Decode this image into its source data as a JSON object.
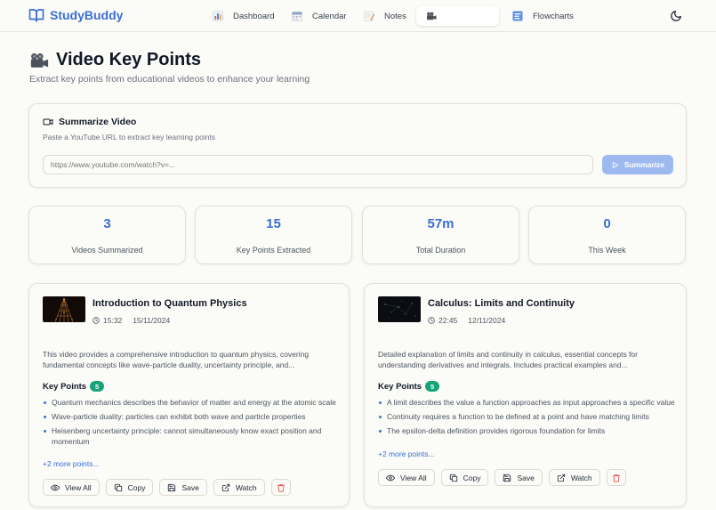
{
  "app": {
    "name": "StudyBuddy",
    "brand_color": "#3b6fd4"
  },
  "nav": {
    "items": [
      {
        "label": "Dashboard",
        "icon": "bar-chart-icon"
      },
      {
        "label": "Calendar",
        "icon": "calendar-icon"
      },
      {
        "label": "Notes",
        "icon": "memo-icon"
      },
      {
        "label": "",
        "icon": "movie-camera-icon",
        "active": true
      },
      {
        "label": "Flowcharts",
        "icon": "chart-icon"
      }
    ],
    "theme_toggle_icon": "moon-icon"
  },
  "header": {
    "title": "Video Key Points",
    "subtitle": "Extract key points from educational videos to enhance your learning"
  },
  "summarize": {
    "title": "Summarize Video",
    "subtitle": "Paste a YouTube URL to extract key learning points",
    "placeholder": "https://www.youtube.com/watch?v=...",
    "button_label": "Summarize"
  },
  "stats": [
    {
      "value": "3",
      "label": "Videos Summarized"
    },
    {
      "value": "15",
      "label": "Key Points Extracted"
    },
    {
      "value": "57m",
      "label": "Total Duration"
    },
    {
      "value": "0",
      "label": "This Week"
    }
  ],
  "videos": [
    {
      "title": "Introduction to Quantum Physics",
      "duration": "15:32",
      "date": "15/11/2024",
      "description": "This video provides a comprehensive introduction to quantum physics, covering fundamental concepts like wave-particle duality, uncertainty principle, and...",
      "key_points_label": "Key Points",
      "key_points_count": "5",
      "key_points": [
        "Quantum mechanics describes the behavior of matter and energy at the atomic scale",
        "Wave-particle duality: particles can exhibit both wave and particle properties",
        "Heisenberg uncertainty principle: cannot simultaneously know exact position and momentum"
      ],
      "more": "+2 more points..."
    },
    {
      "title": "Calculus: Limits and Continuity",
      "duration": "22:45",
      "date": "12/11/2024",
      "description": "Detailed explanation of limits and continuity in calculus, essential concepts for understanding derivatives and integrals. Includes practical examples and...",
      "key_points_label": "Key Points",
      "key_points_count": "5",
      "key_points": [
        "A limit describes the value a function approaches as input approaches a specific value",
        "Continuity requires a function to be defined at a point and have matching limits",
        "The epsilon-delta definition provides rigorous foundation for limits"
      ],
      "more": "+2 more points..."
    }
  ],
  "actions": {
    "view_all": "View All",
    "copy": "Copy",
    "save": "Save",
    "watch": "Watch"
  }
}
